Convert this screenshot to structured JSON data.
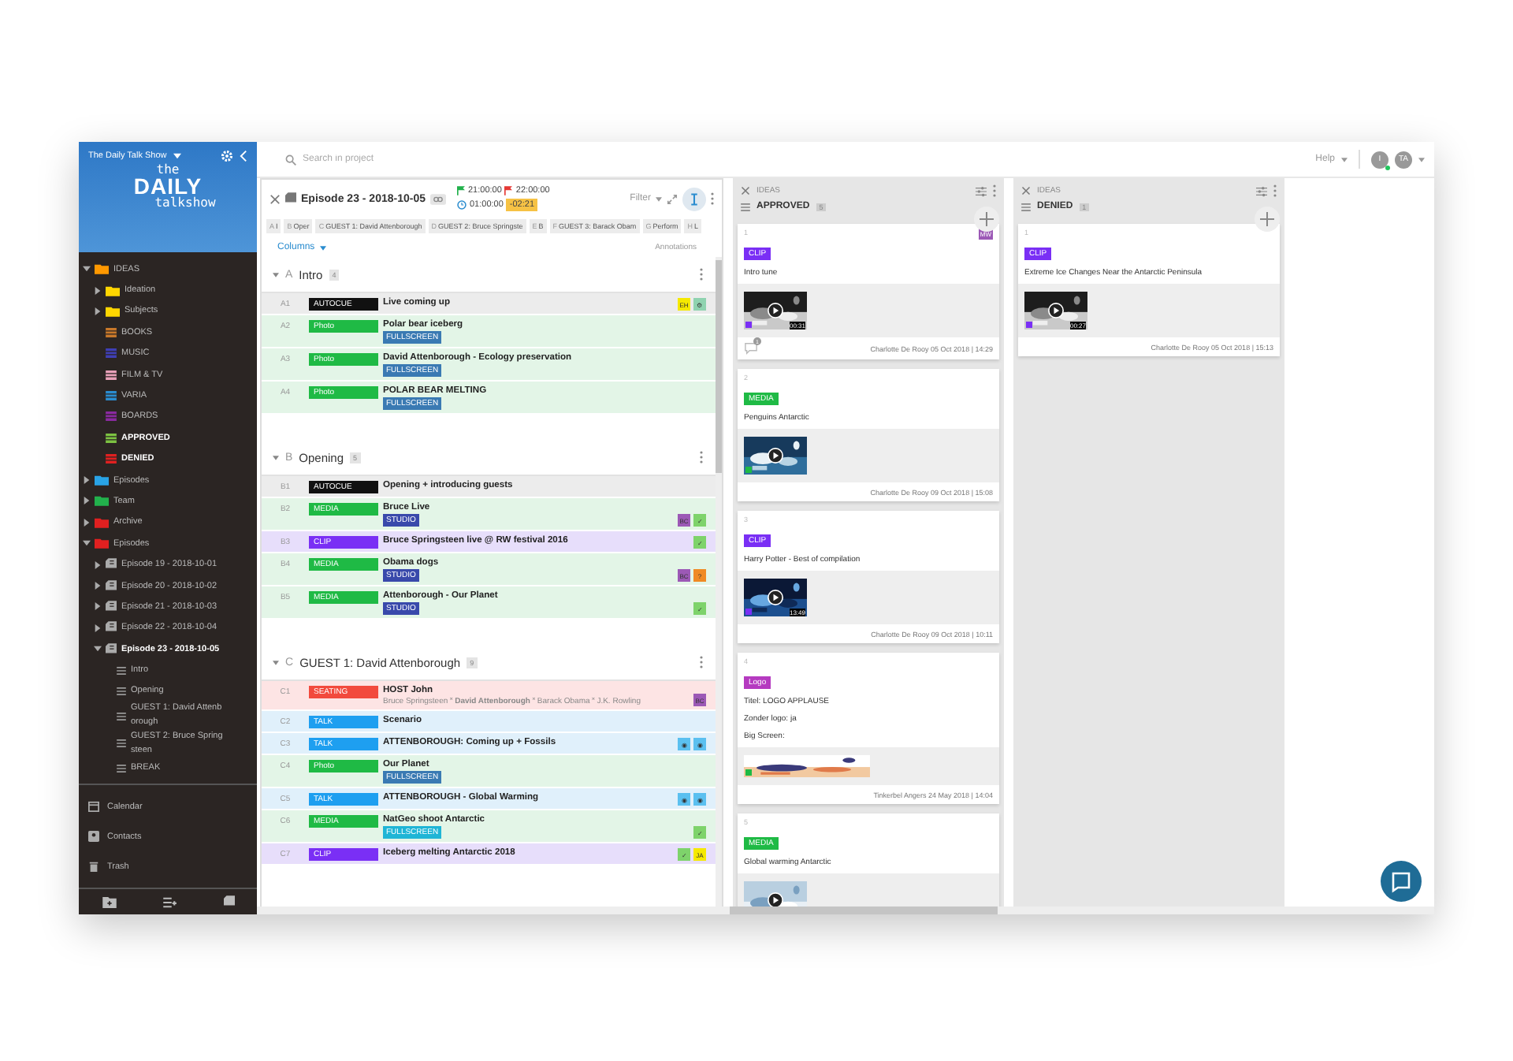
{
  "sidebar": {
    "project": "The Daily Talk Show",
    "logo": {
      "line1": "the",
      "line2": "DAILY",
      "line3": "talkshow"
    },
    "tree": [
      {
        "label": "IDEAS",
        "kind": "folder",
        "color": "#ff9800",
        "open": false,
        "expanded": true,
        "children": [
          {
            "label": "Ideation",
            "kind": "folder",
            "color": "#ffd600",
            "open": false,
            "expanded": false
          },
          {
            "label": "Subjects",
            "kind": "folder",
            "color": "#ffd600",
            "open": false,
            "expanded": false
          },
          {
            "label": "BOOKS",
            "kind": "list",
            "color": "#c8782a",
            "open": false
          },
          {
            "label": "MUSIC",
            "kind": "list",
            "color": "#3f3fb5",
            "open": false
          },
          {
            "label": "FILM & TV",
            "kind": "list",
            "color": "#e8a0b8",
            "open": false
          },
          {
            "label": "VARIA",
            "kind": "list",
            "color": "#2a8ccf",
            "open": false
          },
          {
            "label": "BOARDS",
            "kind": "list",
            "color": "#8a2aa0",
            "open": false
          },
          {
            "label": "APPROVED",
            "kind": "list",
            "color": "#7cc242",
            "open": true
          },
          {
            "label": "DENIED",
            "kind": "list",
            "color": "#e02020",
            "open": true
          }
        ]
      },
      {
        "label": "Episodes",
        "kind": "folder",
        "color": "#29a3e6",
        "open": false,
        "expanded": false
      },
      {
        "label": "Team",
        "kind": "folder",
        "color": "#22b14c",
        "open": false,
        "expanded": false
      },
      {
        "label": "Archive",
        "kind": "folder",
        "color": "#e02020",
        "open": false,
        "expanded": false
      },
      {
        "label": "Episodes",
        "kind": "folder",
        "color": "#e02020",
        "open": false,
        "expanded": true,
        "children": [
          {
            "label": "Episode 19 - 2018-10-01",
            "kind": "episode",
            "open": false,
            "expanded": false
          },
          {
            "label": "Episode 20 - 2018-10-02",
            "kind": "episode",
            "open": false,
            "expanded": false
          },
          {
            "label": "Episode 21 - 2018-10-03",
            "kind": "episode",
            "open": false,
            "expanded": false
          },
          {
            "label": "Episode 22 - 2018-10-04",
            "kind": "episode",
            "open": false,
            "expanded": false
          },
          {
            "label": "Episode 23 - 2018-10-05",
            "kind": "episode",
            "open": true,
            "expanded": true,
            "children": [
              {
                "label": "Intro",
                "kind": "segment",
                "open": false
              },
              {
                "label": "Opening",
                "kind": "segment",
                "open": false
              },
              {
                "label": "GUEST 1: David Attenborough",
                "kind": "segment",
                "open": false
              },
              {
                "label": "GUEST 2: Bruce Springsteen",
                "kind": "segment",
                "open": false
              },
              {
                "label": "BREAK",
                "kind": "segment",
                "open": false
              }
            ]
          }
        ]
      }
    ],
    "nav": [
      {
        "label": "Calendar",
        "kind": "calendar"
      },
      {
        "label": "Contacts",
        "kind": "contacts"
      },
      {
        "label": "Trash",
        "kind": "trash"
      }
    ]
  },
  "topbar": {
    "search": {
      "placeholder": "Search in project"
    },
    "help": "Help",
    "avatars": [
      {
        "initials": "I",
        "online": true
      },
      {
        "initials": "TA",
        "online": false
      }
    ]
  },
  "rundown": {
    "title": "Episode 23 - 2018-10-05",
    "start": "21:00:00",
    "end": "22:00:00",
    "duration": "01:00:00",
    "overrun": "-02:21",
    "filter": "Filter",
    "strip": [
      {
        "letter": "A",
        "label": "I"
      },
      {
        "letter": "B",
        "label": "Oper"
      },
      {
        "letter": "C",
        "label": "GUEST 1: David Attenborough"
      },
      {
        "letter": "D",
        "label": "GUEST 2: Bruce Springste"
      },
      {
        "letter": "E",
        "label": "B"
      },
      {
        "letter": "F",
        "label": "GUEST 3: Barack Obam"
      },
      {
        "letter": "G",
        "label": "Perform"
      },
      {
        "letter": "H",
        "label": "L"
      }
    ],
    "columns_label": "Columns",
    "annotations_label": "Annotations",
    "sections": [
      {
        "letter": "A",
        "title": "Intro",
        "count": "4",
        "rows": [
          {
            "id": "A1",
            "kind": "autocue",
            "badge": "AUTOCUE",
            "title": "Live coming up",
            "marks": [
              {
                "label": "EH",
                "color": "#f5e900"
              },
              {
                "label": "⚙",
                "color": "#8fd3b0"
              }
            ]
          },
          {
            "id": "A2",
            "badge": "Photo",
            "title": "Polar bear iceberg",
            "tag": {
              "label": "FULLSCREEN",
              "color": "#3a7ab3"
            },
            "marks": []
          },
          {
            "id": "A3",
            "badge": "Photo",
            "title": "David Attenborough - Ecology preservation",
            "tag": {
              "label": "FULLSCREEN",
              "color": "#3a7ab3"
            },
            "marks": []
          },
          {
            "id": "A4",
            "badge": "Photo",
            "title": "POLAR BEAR MELTING",
            "tag": {
              "label": "FULLSCREEN",
              "color": "#3a7ab3"
            },
            "marks": []
          }
        ]
      },
      {
        "letter": "B",
        "title": "Opening",
        "count": "5",
        "rows": [
          {
            "id": "B1",
            "kind": "autocue",
            "badge": "AUTOCUE",
            "title": "Opening + introducing guests",
            "marks": []
          },
          {
            "id": "B2",
            "kind": "media",
            "badge": "MEDIA",
            "title": "Bruce Live",
            "tag": {
              "label": "STUDIO",
              "color": "#3949ab"
            },
            "marks": [
              {
                "label": "BC",
                "color": "#9c59b6"
              },
              {
                "label": "✓",
                "color": "#7ed36b"
              }
            ]
          },
          {
            "id": "B3",
            "kind": "clip",
            "badge": "CLIP",
            "title": "Bruce Springsteen live @ RW festival 2016",
            "marks": [
              {
                "label": "✓",
                "color": "#7ed36b"
              }
            ]
          },
          {
            "id": "B4",
            "kind": "media",
            "badge": "MEDIA",
            "title": "Obama dogs",
            "tag": {
              "label": "STUDIO",
              "color": "#3949ab"
            },
            "marks": [
              {
                "label": "BC",
                "color": "#9c59b6"
              },
              {
                "label": "?",
                "color": "#f08a24"
              }
            ]
          },
          {
            "id": "B5",
            "kind": "media",
            "badge": "MEDIA",
            "title": "Attenborough - Our Planet",
            "tag": {
              "label": "STUDIO",
              "color": "#3949ab"
            },
            "marks": [
              {
                "label": "✓",
                "color": "#7ed36b"
              }
            ]
          }
        ]
      },
      {
        "letter": "C",
        "title": "GUEST 1: David Attenborough",
        "count": "9",
        "rows": [
          {
            "id": "C1",
            "kind": "seating",
            "badge": "SEATING",
            "title": "HOST John",
            "people": "Bruce Springsteen ˟ **David Attenborough** ˟ Barack Obama ˟ J.K. Rowling",
            "marks": [
              {
                "label": "BC",
                "color": "#9c59b6"
              }
            ]
          },
          {
            "id": "C2",
            "kind": "talk",
            "badge": "TALK",
            "title": "Scenario",
            "marks": []
          },
          {
            "id": "C3",
            "kind": "talk",
            "badge": "TALK",
            "title": "ATTENBOROUGH: Coming up + Fossils",
            "marks": [
              {
                "label": "◉",
                "color": "#5bc0f0"
              },
              {
                "label": "◉",
                "color": "#5bc0f0"
              }
            ]
          },
          {
            "id": "C4",
            "badge": "Photo",
            "title": "Our Planet",
            "tag": {
              "label": "FULLSCREEN",
              "color": "#3a7ab3"
            },
            "marks": []
          },
          {
            "id": "C5",
            "kind": "talk",
            "badge": "TALK",
            "title": "ATTENBOROUGH - Global Warming",
            "marks": [
              {
                "label": "◉",
                "color": "#5bc0f0"
              },
              {
                "label": "◉",
                "color": "#5bc0f0"
              }
            ]
          },
          {
            "id": "C6",
            "kind": "media",
            "badge": "MEDIA",
            "title": "NatGeo shoot Antarctic",
            "tag": {
              "label": "FULLSCREEN",
              "color": "#1fb5d6"
            },
            "marks": [
              {
                "label": "✓",
                "color": "#7ed36b"
              }
            ]
          },
          {
            "id": "C7",
            "kind": "clip",
            "badge": "CLIP",
            "title": "Iceberg melting Antarctic 2018",
            "marks": [
              {
                "label": "✓",
                "color": "#7ed36b"
              },
              {
                "label": "JA",
                "color": "#f5e900"
              }
            ]
          }
        ]
      }
    ]
  },
  "columns": [
    {
      "parent": "IDEAS",
      "title": "APPROVED",
      "count": "5",
      "cards": [
        {
          "number": "1",
          "kind": "clip",
          "badge": "CLIP",
          "lines": [
            "Intro tune"
          ],
          "thumb": {
            "video": true,
            "wide": false,
            "duration": "00:31"
          },
          "comments": "1",
          "assignee": "MW",
          "footer": "Charlotte De Rooy 05 Oct 2018 | 14:29"
        },
        {
          "number": "2",
          "kind": "media",
          "badge": "MEDIA",
          "lines": [
            "Penguins Antarctic"
          ],
          "thumb": {
            "video": true,
            "wide": false
          },
          "footer": "Charlotte De Rooy 09 Oct 2018 | 15:08"
        },
        {
          "number": "3",
          "kind": "clip",
          "badge": "CLIP",
          "lines": [
            "Harry Potter - Best of compilation"
          ],
          "thumb": {
            "video": true,
            "wide": false,
            "duration": "13:49"
          },
          "footer": "Charlotte De Rooy 09 Oct 2018 | 10:11"
        },
        {
          "number": "4",
          "kind": "logo",
          "badge": "Logo",
          "lines": [
            "Titel: LOGO APPLAUSE",
            "Zonder logo: ja",
            "Big Screen:"
          ],
          "thumb": {
            "video": false,
            "wide": true
          },
          "footer": "Tinkerbel Angers 24 May 2018 | 14:04"
        },
        {
          "number": "5",
          "kind": "media",
          "badge": "MEDIA",
          "lines": [
            "Global warming Antarctic"
          ],
          "thumb": {
            "video": true,
            "wide": false
          }
        }
      ]
    },
    {
      "parent": "IDEAS",
      "title": "DENIED",
      "count": "1",
      "cards": [
        {
          "number": "1",
          "kind": "clip",
          "badge": "CLIP",
          "lines": [
            "Extreme Ice Changes Near the Antarctic Peninsula"
          ],
          "thumb": {
            "video": true,
            "wide": false,
            "duration": "00:27"
          },
          "footer": "Charlotte De Rooy 05 Oct 2018 | 15:13"
        }
      ]
    }
  ]
}
